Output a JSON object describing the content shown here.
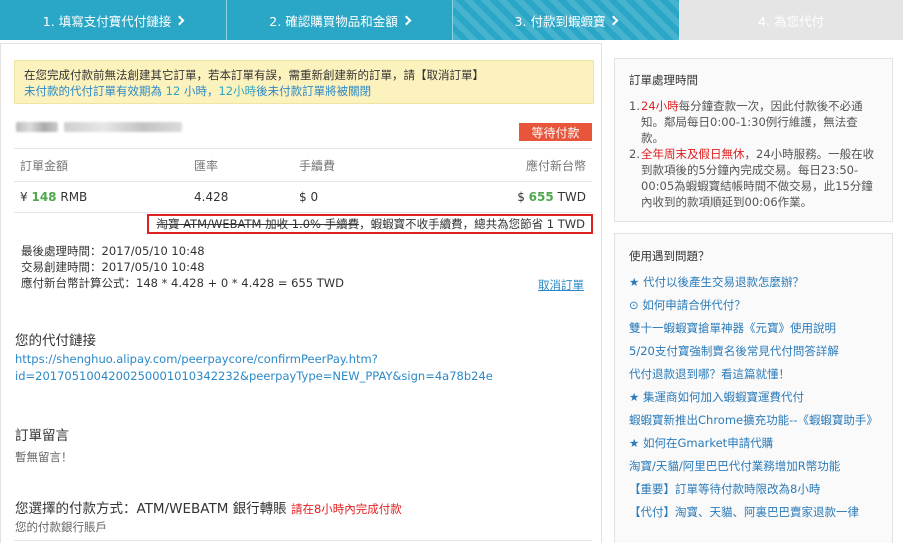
{
  "steps": [
    {
      "label": "1. 填寫支付寶代付鏈接"
    },
    {
      "label": "2. 確認購買物品和金額"
    },
    {
      "label": "3. 付款到蝦蝦寶"
    },
    {
      "label": "4. 為您代付"
    }
  ],
  "notice": {
    "line1": "在您完成付款前無法創建其它訂單，若本訂單有誤，需重新創建新的訂單，請【取消訂單】",
    "line2_a": "未付款的代付訂單有效期為",
    "line2_hours": "12",
    "line2_b": "小時，",
    "line2_em": "12小時",
    "line2_c": "後未付款訂單將被關閉"
  },
  "status_badge": "等待付款",
  "table": {
    "headers": [
      "訂單金額",
      "匯率",
      "手續費",
      "應付新台幣"
    ],
    "amount_prefix": "¥",
    "amount": "148",
    "amount_unit": "RMB",
    "rate": "4.428",
    "fee": "$ 0",
    "pay_prefix": "$",
    "pay": "655",
    "pay_unit": "TWD"
  },
  "savings": {
    "struck": "淘寶 ATM/WEBATM 加收 1.0% 手續費",
    "rest": "，蝦蝦寶不收手續費，總共為您節省 1 TWD"
  },
  "times": {
    "last_processed": "最後處理時間：2017/05/10 10:48",
    "created": "交易創建時間：2017/05/10 10:48",
    "formula": "應付新台幣計算公式：148 * 4.428 + 0 * 4.428 = 655 TWD"
  },
  "cancel_link": "取消訂單",
  "pay_link": {
    "title": "您的代付鏈接",
    "line1": "https://shenghuo.alipay.com/peerpaycore/confirmPeerPay.htm?",
    "line2": "id=2017051004200250001010342232&peerpayType=NEW_PPAY&sign=4a78b24e"
  },
  "message": {
    "title": "訂單留言",
    "empty": "暫無留言！"
  },
  "payment": {
    "title": "您選擇的付款方式：ATM/WEBATM 銀行轉賬",
    "note": "請在8小時內完成付款",
    "account": "您的付款銀行賬戶"
  },
  "processing": {
    "title": "訂單處理時間",
    "items": [
      {
        "num": "1.",
        "em": "24小時",
        "text": "每分鐘查款一次，因此付款後不必通知。鄰局每日0:00-1:30例行維護，無法查款。"
      },
      {
        "num": "2.",
        "em": "全年周末及假日無休",
        "text": "，24小時服務。一般在收到款項後的5分鐘內完成交易。每日23:50-00:05為蝦蝦寶結帳時間不做交易，此15分鐘內收到的款項順延到00:06作業。"
      }
    ]
  },
  "help": {
    "title": "使用遇到問題？",
    "links": [
      "★ 代付以後產生交易退款怎麼辦？",
      "⊙ 如何申請合併代付？",
      "雙十一蝦蝦寶搶單神器《元寶》使用說明",
      "5/20支付寶強制賣名後常見代付問答詳解",
      "代付退款退到哪？看這篇就懂！",
      "★ 集運商如何加入蝦蝦寶運費代付",
      "蝦蝦寶新推出Chrome擴充功能--《蝦蝦寶助手》",
      "★ 如何在Gmarket申請代購",
      "淘寶/天貓/阿里巴巴代付業務增加R幣功能",
      "【重要】訂單等待付款時限改為8小時",
      "【代付】淘寶、天貓、阿裏巴巴賣家退款一律"
    ]
  }
}
